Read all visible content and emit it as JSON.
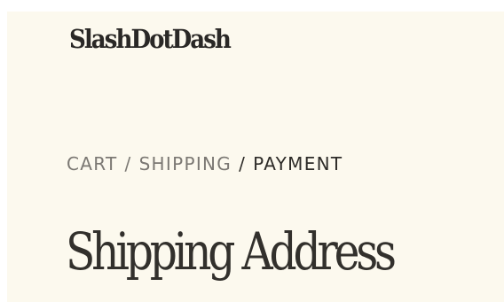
{
  "header": {
    "logo_text": "SlashDotDash"
  },
  "breadcrumb": {
    "items": [
      {
        "label": "CART",
        "state": "link"
      },
      {
        "label": "SHIPPING",
        "state": "link"
      },
      {
        "label": "PAYMENT",
        "state": "current"
      }
    ],
    "separator": "/"
  },
  "main": {
    "title": "Shipping Address"
  },
  "colors": {
    "background": "#fcf9ee",
    "text_dark": "#2d2b28",
    "text_muted": "#7b7873"
  }
}
